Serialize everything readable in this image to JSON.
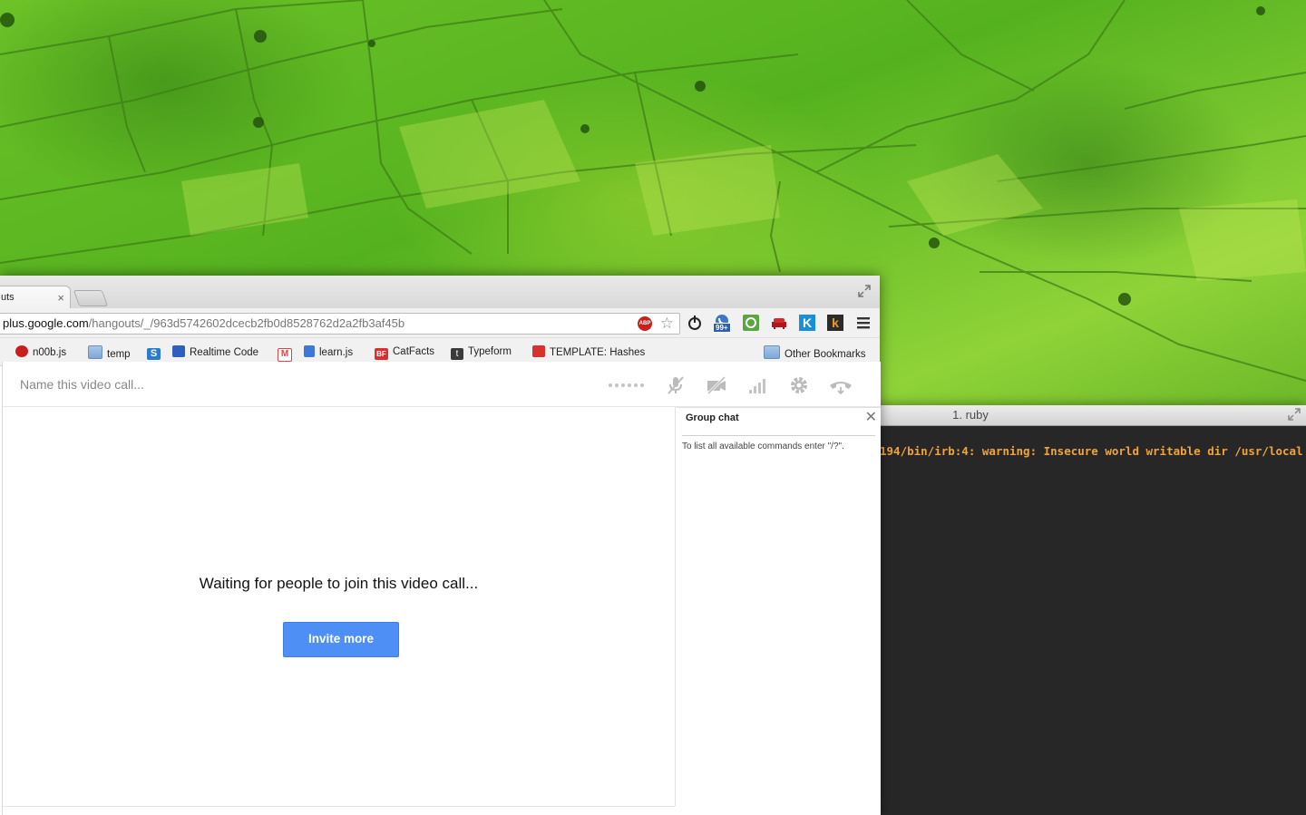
{
  "terminal": {
    "title": "1. ruby",
    "output_line": "194/bin/irb:4: warning: Insecure world writable dir /usr/local in"
  },
  "browser": {
    "tab_title": "uts",
    "tab_close": "×",
    "url_host": "plus.google.com",
    "url_path": "/hangouts/_/963d5742602dcecb2fb0d8528762d2a2fb3af45b",
    "adblock_label": "ABP",
    "extension_badge": "99+",
    "bookmarks": [
      {
        "label": "n00b.js"
      },
      {
        "label": "temp"
      },
      {
        "label": "Realtime Code"
      },
      {
        "label": "learn.js"
      },
      {
        "label": "CatFacts"
      },
      {
        "label": "Typeform"
      },
      {
        "label": "TEMPLATE: Hashes"
      },
      {
        "label": "Other Bookmarks"
      }
    ]
  },
  "hangout": {
    "name_placeholder": "Name this video call...",
    "waiting_message": "Waiting for people to join this video call...",
    "invite_button": "Invite more"
  },
  "group_chat": {
    "title": "Group chat",
    "close": "✕",
    "hint": "To list all available commands enter \"/?\"."
  },
  "colors": {
    "invite_blue": "#4d8ff5",
    "terminal_text": "#f0a43a",
    "terminal_bg": "#272727"
  }
}
